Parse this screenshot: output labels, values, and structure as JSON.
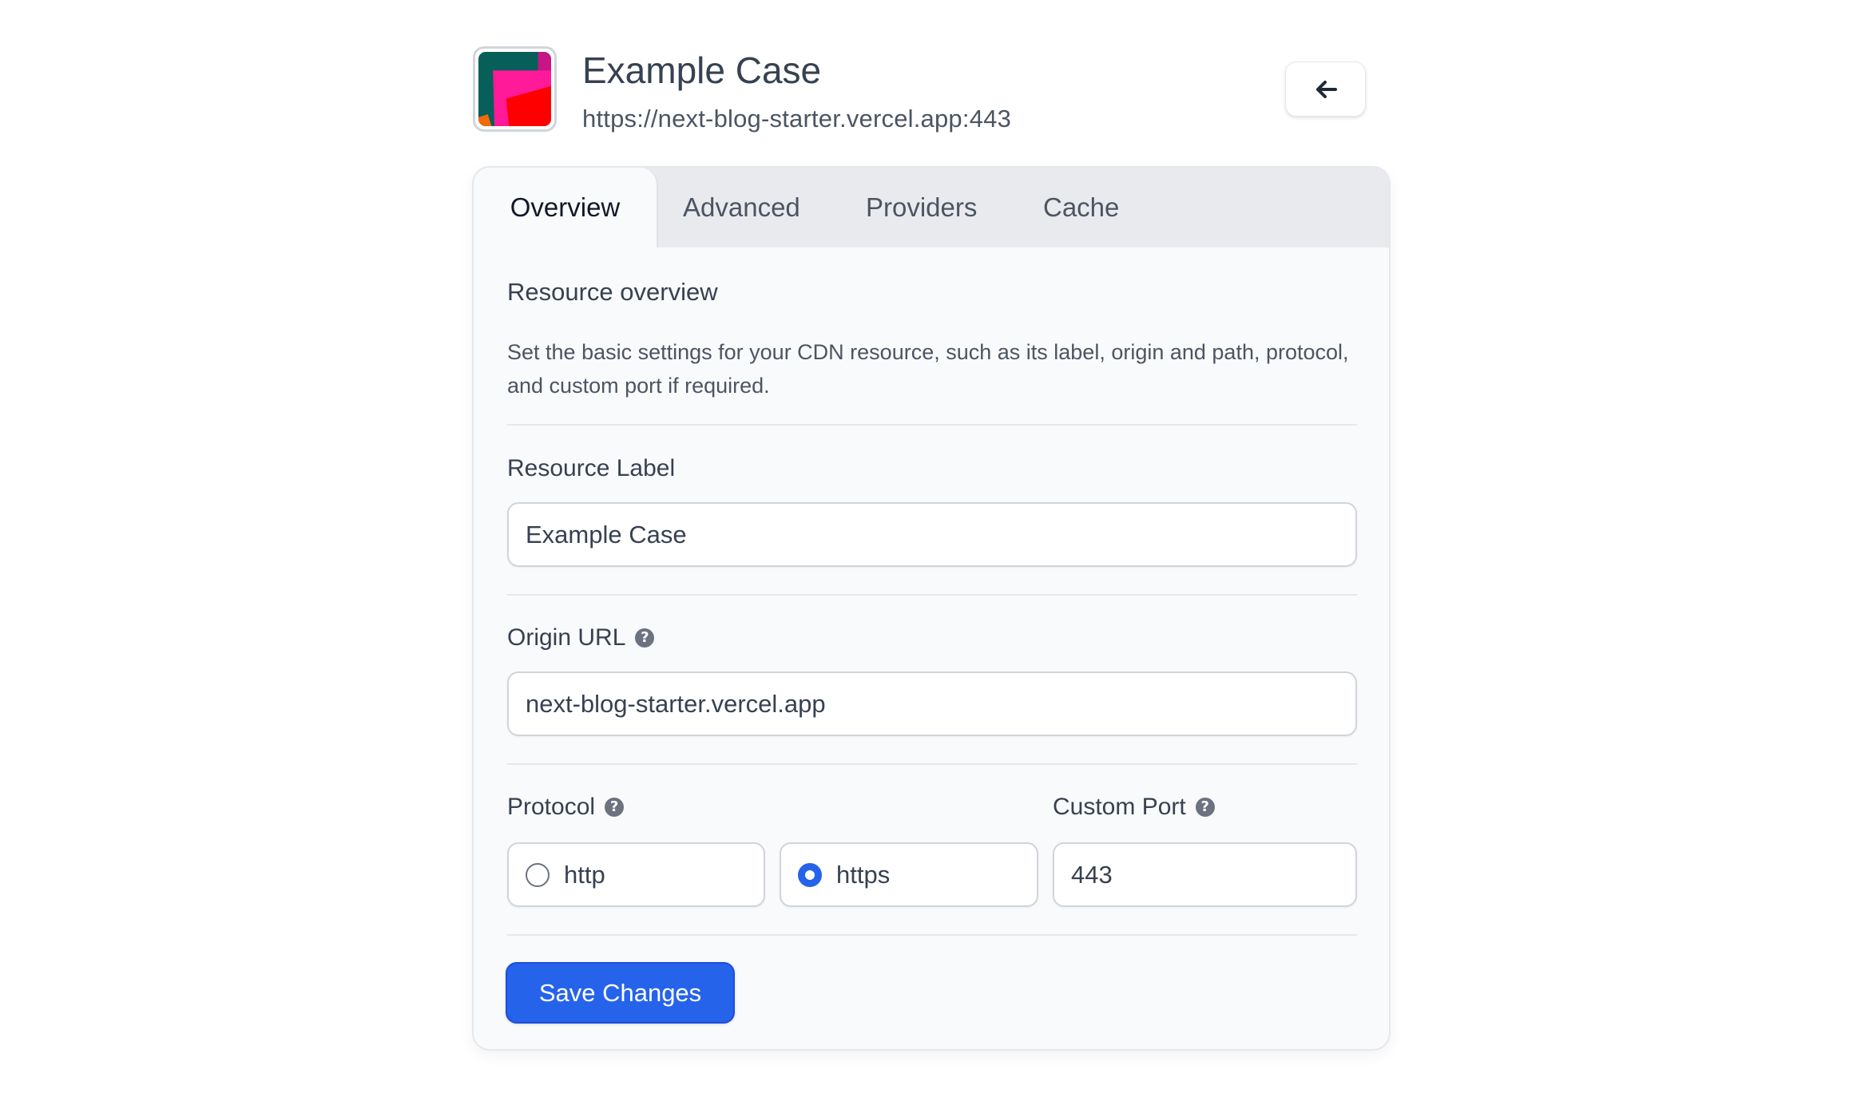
{
  "header": {
    "title": "Example Case",
    "subtitle": "https://next-blog-starter.vercel.app:443",
    "logo_icon": "resource-logo",
    "back_icon": "arrow-left-icon"
  },
  "tabs": [
    {
      "label": "Overview",
      "active": true
    },
    {
      "label": "Advanced",
      "active": false
    },
    {
      "label": "Providers",
      "active": false
    },
    {
      "label": "Cache",
      "active": false
    }
  ],
  "overview": {
    "title": "Resource overview",
    "description": "Set the basic settings for your CDN resource, such as its label, origin and path, protocol, and custom port if required."
  },
  "form": {
    "resource_label": {
      "label": "Resource Label",
      "value": "Example Case"
    },
    "origin_url": {
      "label": "Origin URL",
      "value": "next-blog-starter.vercel.app",
      "help_icon": "question-circle-icon"
    },
    "protocol": {
      "label": "Protocol",
      "help_icon": "question-circle-icon",
      "options": [
        {
          "label": "http",
          "selected": false
        },
        {
          "label": "https",
          "selected": true
        }
      ]
    },
    "custom_port": {
      "label": "Custom Port",
      "value": "443",
      "help_icon": "question-circle-icon"
    },
    "save_label": "Save Changes"
  },
  "colors": {
    "accent": "#2563eb",
    "tab_bar_bg": "#e9eaee",
    "card_bg": "#f9fafb",
    "text": "#374151"
  }
}
